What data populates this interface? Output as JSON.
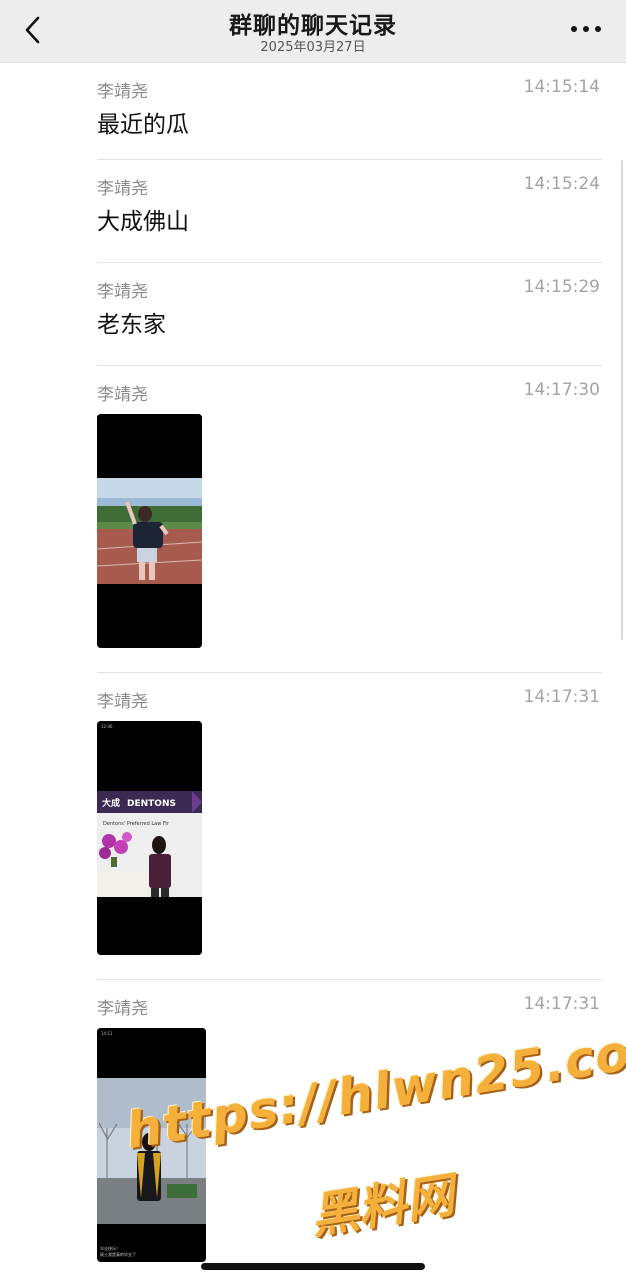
{
  "header": {
    "title": "群聊的聊天记录",
    "date": "2025年03月27日",
    "back_icon": "chevron-left-icon",
    "more_icon": "more-dots-icon"
  },
  "messages": [
    {
      "sender": "李靖尧",
      "time": "14:15:14",
      "text": "最近的瓜"
    },
    {
      "sender": "李靖尧",
      "time": "14:15:24",
      "text": "大成佛山"
    },
    {
      "sender": "李靖尧",
      "time": "14:15:29",
      "text": "老东家"
    },
    {
      "sender": "李靖尧",
      "time": "14:17:30",
      "image": "photo-girl-track"
    },
    {
      "sender": "李靖尧",
      "time": "14:17:31",
      "image": "photo-dentons-office",
      "image_text": {
        "status_time": "12:06",
        "logo_cn": "大成",
        "logo_en": "DENTONS",
        "banner": "Dentons' Preferred Law Fir"
      }
    },
    {
      "sender": "李靖尧",
      "time": "14:17:31",
      "image": "photo-graduation",
      "image_text": {
        "status_time": "14:11",
        "caption_line1": "毕业快乐！",
        "caption_line2": "硕士我是真的毕业了"
      }
    }
  ],
  "watermark": {
    "line1": "https://hlwn25.com",
    "line2": "黑料网"
  }
}
